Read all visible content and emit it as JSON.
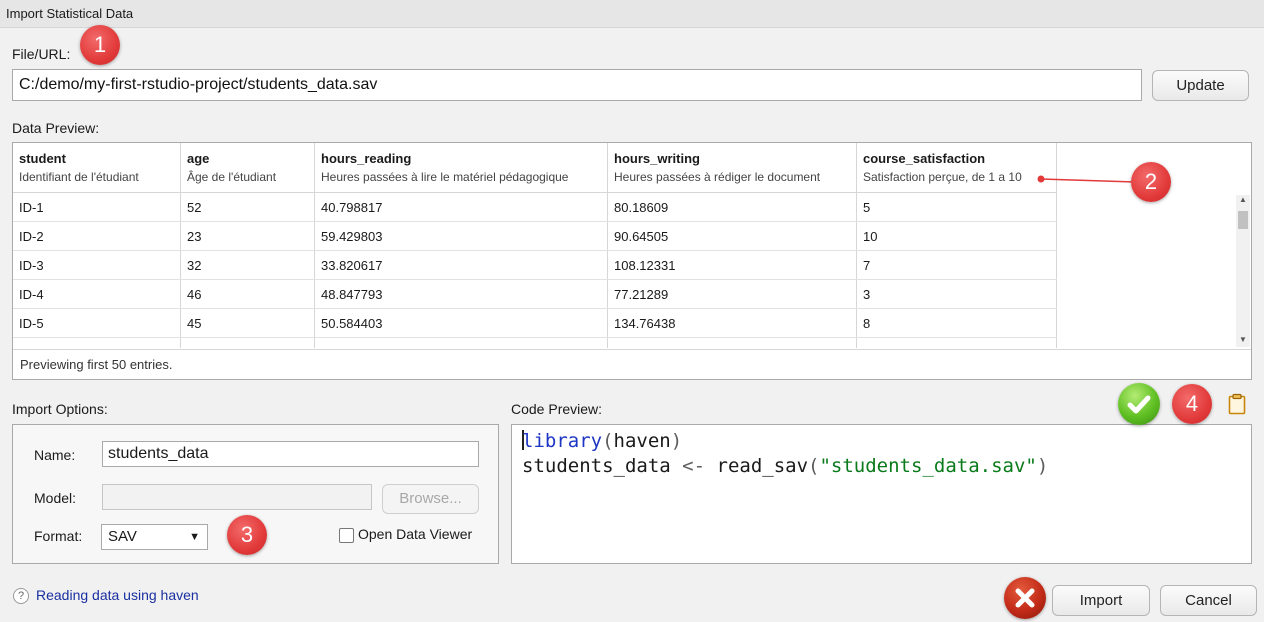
{
  "window": {
    "title": "Import Statistical Data"
  },
  "file_url": {
    "label": "File/URL:",
    "value": "C:/demo/my-first-rstudio-project/students_data.sav",
    "update_label": "Update"
  },
  "data_preview": {
    "label": "Data Preview:",
    "columns": [
      {
        "name": "student",
        "label": "Identifiant de l'étudiant"
      },
      {
        "name": "age",
        "label": "Âge de l'étudiant"
      },
      {
        "name": "hours_reading",
        "label": "Heures passées à lire le matériel pédagogique"
      },
      {
        "name": "hours_writing",
        "label": "Heures passées à rédiger le document"
      },
      {
        "name": "course_satisfaction",
        "label": "Satisfaction perçue, de 1 a 10"
      }
    ],
    "rows": [
      [
        "ID-1",
        "52",
        "40.798817",
        "80.18609",
        "5"
      ],
      [
        "ID-2",
        "23",
        "59.429803",
        "90.64505",
        "10"
      ],
      [
        "ID-3",
        "32",
        "33.820617",
        "108.12331",
        "7"
      ],
      [
        "ID-4",
        "46",
        "48.847793",
        "77.21289",
        "3"
      ],
      [
        "ID-5",
        "45",
        "50.584403",
        "134.76438",
        "8"
      ]
    ],
    "footer": "Previewing first 50 entries."
  },
  "import_options": {
    "label": "Import Options:",
    "name_label": "Name:",
    "name_value": "students_data",
    "model_label": "Model:",
    "model_value": "",
    "browse_label": "Browse...",
    "format_label": "Format:",
    "format_value": "SAV",
    "open_viewer_label": "Open Data Viewer",
    "open_viewer_checked": false
  },
  "code_preview": {
    "label": "Code Preview:",
    "line1": {
      "fn": "library",
      "open": "(",
      "arg": "haven",
      "close": ")"
    },
    "line2": {
      "var": "students_data",
      "assign": "<-",
      "fn": "read_sav",
      "open": "(",
      "arg": "\"students_data.sav\"",
      "close": ")"
    }
  },
  "annotations": {
    "b1": "1",
    "b2": "2",
    "b3": "3",
    "b4": "4"
  },
  "help": {
    "link_label": "Reading data using haven",
    "icon": "?"
  },
  "actions": {
    "import_label": "Import",
    "cancel_label": "Cancel"
  },
  "colors": {
    "keyword": "#1d36c4",
    "string": "#0a7a1b",
    "badge": "#e23a3a",
    "ok": "#5fbf22",
    "cancel_x": "#c22b18"
  }
}
